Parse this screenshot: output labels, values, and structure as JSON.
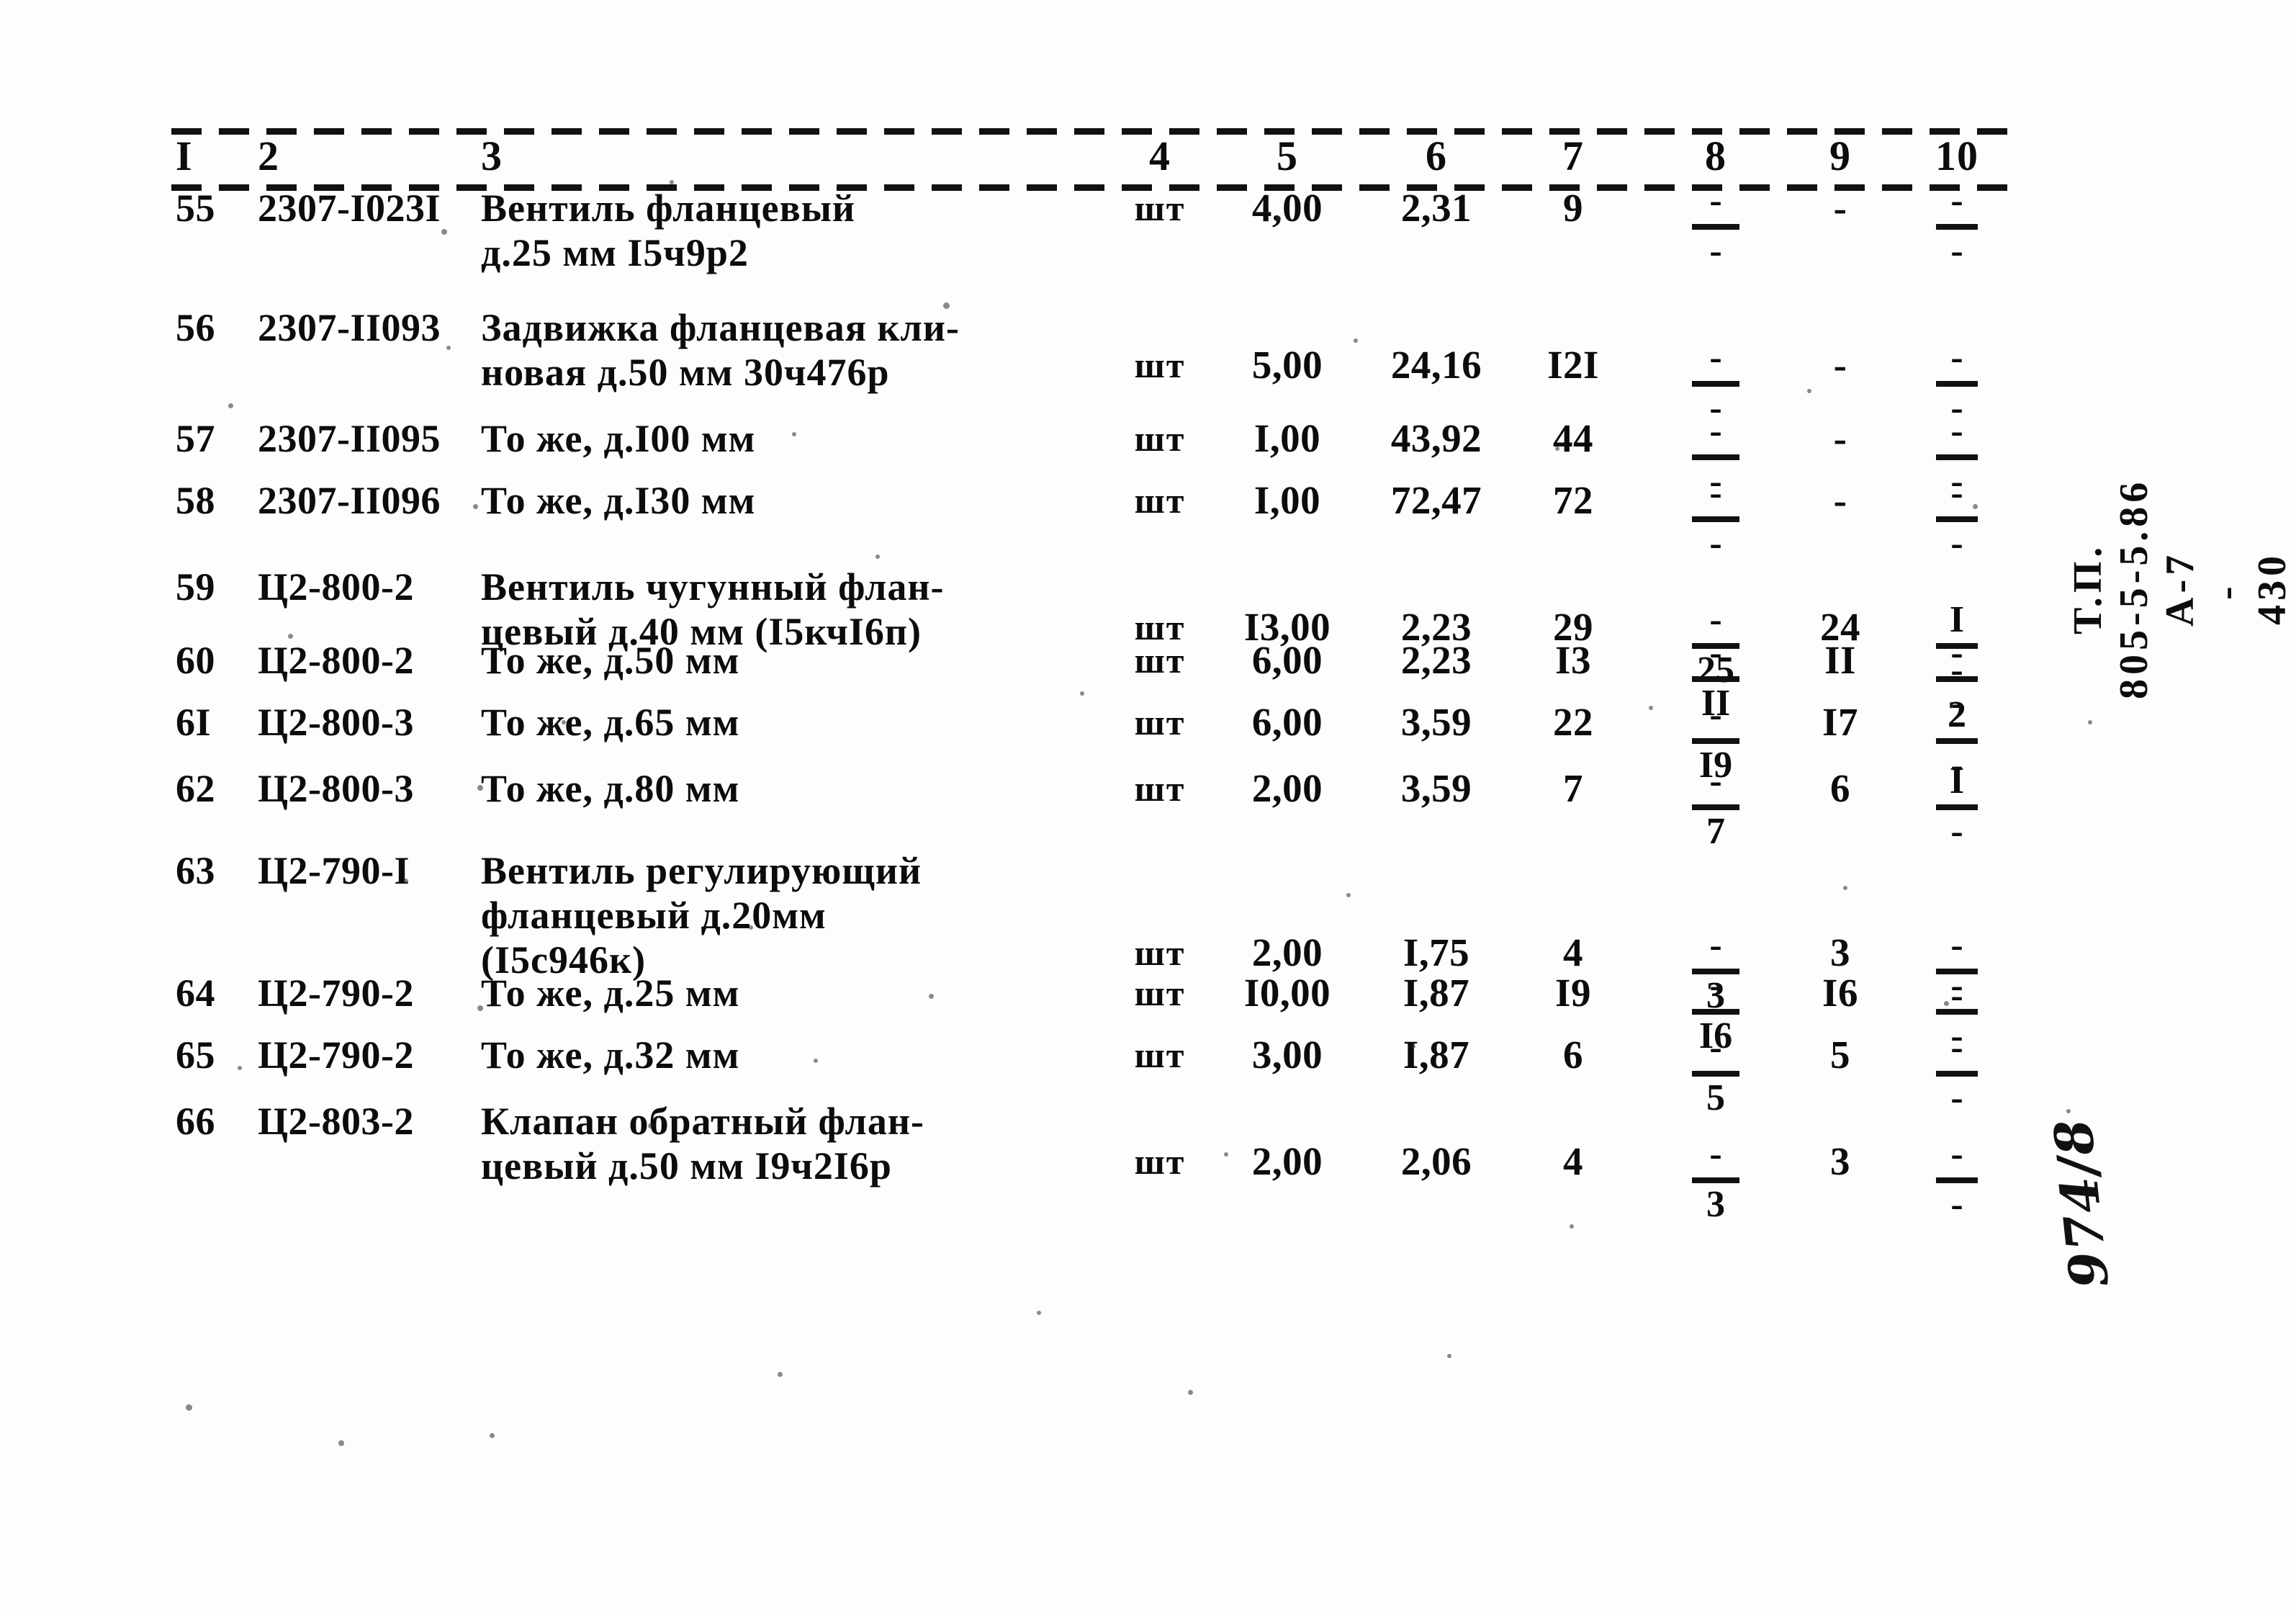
{
  "document": {
    "kind": "scanned-specification-table",
    "side_stamp": [
      "Т.П.",
      "805-5-5.86",
      "А-7",
      "-",
      "430",
      "-"
    ],
    "archive_mark": "974/8"
  },
  "table": {
    "column_headers": [
      "I",
      "2",
      "3",
      "4",
      "5",
      "6",
      "7",
      "8",
      "9",
      "10"
    ],
    "rows": [
      {
        "no": "55",
        "code": "2307-I023I",
        "description": "Вентиль фланцевый\nд.25 мм I5ч9р2",
        "unit": "шт",
        "qty": "4,00",
        "price": "2,31",
        "sum": "9",
        "col8": {
          "numerator": "-",
          "denominator": "-"
        },
        "col9": "-",
        "col10": {
          "numerator": "-",
          "denominator": "-"
        }
      },
      {
        "no": "56",
        "code": "2307-II093",
        "description": "Задвижка фланцевая кли-\nновая д.50 мм 30ч476р",
        "unit": "шт",
        "qty": "5,00",
        "price": "24,16",
        "sum": "I2I",
        "col8": {
          "numerator": "-",
          "denominator": "-"
        },
        "col9": "-",
        "col10": {
          "numerator": "-",
          "denominator": "-"
        }
      },
      {
        "no": "57",
        "code": "2307-II095",
        "description": "То же, д.I00 мм",
        "unit": "шт",
        "qty": "I,00",
        "price": "43,92",
        "sum": "44",
        "col8": {
          "numerator": "-",
          "denominator": "-"
        },
        "col9": "-",
        "col10": {
          "numerator": "-",
          "denominator": "-"
        }
      },
      {
        "no": "58",
        "code": "2307-II096",
        "description": "То же, д.I30 мм",
        "unit": "шт",
        "qty": "I,00",
        "price": "72,47",
        "sum": "72",
        "col8": {
          "numerator": "-",
          "denominator": "-"
        },
        "col9": "-",
        "col10": {
          "numerator": "-",
          "denominator": "-"
        }
      },
      {
        "no": "59",
        "code": "Ц2-800-2",
        "description": "Вентиль чугунный флан-\nцевый д.40 мм (I5кчI6п)",
        "unit": "шт",
        "qty": "I3,00",
        "price": "2,23",
        "sum": "29",
        "col8": {
          "numerator": "-",
          "denominator": "25"
        },
        "col9": "24",
        "col10": {
          "numerator": "I",
          "denominator": "-"
        }
      },
      {
        "no": "60",
        "code": "Ц2-800-2",
        "description": "То же, д.50 мм",
        "unit": "шт",
        "qty": "6,00",
        "price": "2,23",
        "sum": "I3",
        "col8": {
          "numerator": "-",
          "denominator": "II"
        },
        "col9": "II",
        "col10": {
          "numerator": "-",
          "denominator": "-"
        }
      },
      {
        "no": "6I",
        "code": "Ц2-800-3",
        "description": "То же, д.65 мм",
        "unit": "шт",
        "qty": "6,00",
        "price": "3,59",
        "sum": "22",
        "col8": {
          "numerator": "-",
          "denominator": "I9"
        },
        "col9": "I7",
        "col10": {
          "numerator": "2",
          "denominator": "-"
        }
      },
      {
        "no": "62",
        "code": "Ц2-800-3",
        "description": "То же, д.80 мм",
        "unit": "шт",
        "qty": "2,00",
        "price": "3,59",
        "sum": "7",
        "col8": {
          "numerator": "-",
          "denominator": "7"
        },
        "col9": "6",
        "col10": {
          "numerator": "I",
          "denominator": "-"
        }
      },
      {
        "no": "63",
        "code": "Ц2-790-I",
        "description": "Вентиль регулирующий\nфланцевый д.20мм\n(I5с946к)",
        "unit": "шт",
        "qty": "2,00",
        "price": "I,75",
        "sum": "4",
        "col8": {
          "numerator": "-",
          "denominator": "3"
        },
        "col9": "3",
        "col10": {
          "numerator": "-",
          "denominator": "-"
        }
      },
      {
        "no": "64",
        "code": "Ц2-790-2",
        "description": "То же, д.25 мм",
        "unit": "шт",
        "qty": "I0,00",
        "price": "I,87",
        "sum": "I9",
        "col8": {
          "numerator": "-",
          "denominator": "I6"
        },
        "col9": "I6",
        "col10": {
          "numerator": "-",
          "denominator": "-"
        }
      },
      {
        "no": "65",
        "code": "Ц2-790-2",
        "description": "То же, д.32 мм",
        "unit": "шт",
        "qty": "3,00",
        "price": "I,87",
        "sum": "6",
        "col8": {
          "numerator": "-",
          "denominator": "5"
        },
        "col9": "5",
        "col10": {
          "numerator": "-",
          "denominator": "-"
        }
      },
      {
        "no": "66",
        "code": "Ц2-803-2",
        "description": "Клапан обратный флан-\nцевый д.50 мм I9ч2I6р",
        "unit": "шт",
        "qty": "2,00",
        "price": "2,06",
        "sum": "4",
        "col8": {
          "numerator": "-",
          "denominator": "3"
        },
        "col9": "3",
        "col10": {
          "numerator": "-",
          "denominator": "-"
        }
      }
    ]
  }
}
